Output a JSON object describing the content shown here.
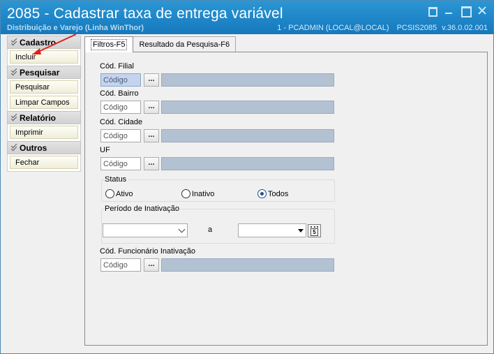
{
  "window": {
    "title": "2085 - Cadastrar taxa de entrega variável",
    "subtitle": "Distribuição e Varejo (Linha WinThor)",
    "session": "1 - PCADMIN (LOCAL@LOCAL)",
    "program": "PCSIS2085",
    "version": "v.36.0.02.001"
  },
  "sidebar": {
    "groups": [
      {
        "title": "Cadastro",
        "items": [
          "Incluir"
        ]
      },
      {
        "title": "Pesquisar",
        "items": [
          "Pesquisar",
          "Limpar Campos"
        ]
      },
      {
        "title": "Relatório",
        "items": [
          "Imprimir"
        ]
      },
      {
        "title": "Outros",
        "items": [
          "Fechar"
        ]
      }
    ]
  },
  "tabs": [
    {
      "label": "Filtros-F5",
      "active": true
    },
    {
      "label": "Resultado da Pesquisa-F6",
      "active": false
    }
  ],
  "form": {
    "filial": {
      "label": "Cód. Filial",
      "placeholder": "Código",
      "button": "..."
    },
    "bairro": {
      "label": "Cód. Bairro",
      "placeholder": "Código",
      "button": "..."
    },
    "cidade": {
      "label": "Cód. Cidade",
      "placeholder": "Código",
      "button": "..."
    },
    "uf": {
      "label": "UF",
      "placeholder": "Código",
      "button": "..."
    },
    "status": {
      "legend": "Status",
      "options": [
        "Ativo",
        "Inativo",
        "Todos"
      ],
      "selected": "Todos"
    },
    "periodo": {
      "legend": "Período de Inativação",
      "separator": "a",
      "calendar_day": "5"
    },
    "funcionario": {
      "label": "Cód. Funcionário Inativação",
      "placeholder": "Código",
      "button": "..."
    }
  },
  "colors": {
    "titlebar": "#1e86c8",
    "annotation_arrow": "#e02020",
    "readonly_field": "#b3c2d2"
  },
  "icons": [
    "restore-icon",
    "minimize-icon",
    "maximize-icon",
    "close-icon",
    "chevron-up-icon",
    "calendar-icon",
    "dropdown-arrow-icon"
  ]
}
